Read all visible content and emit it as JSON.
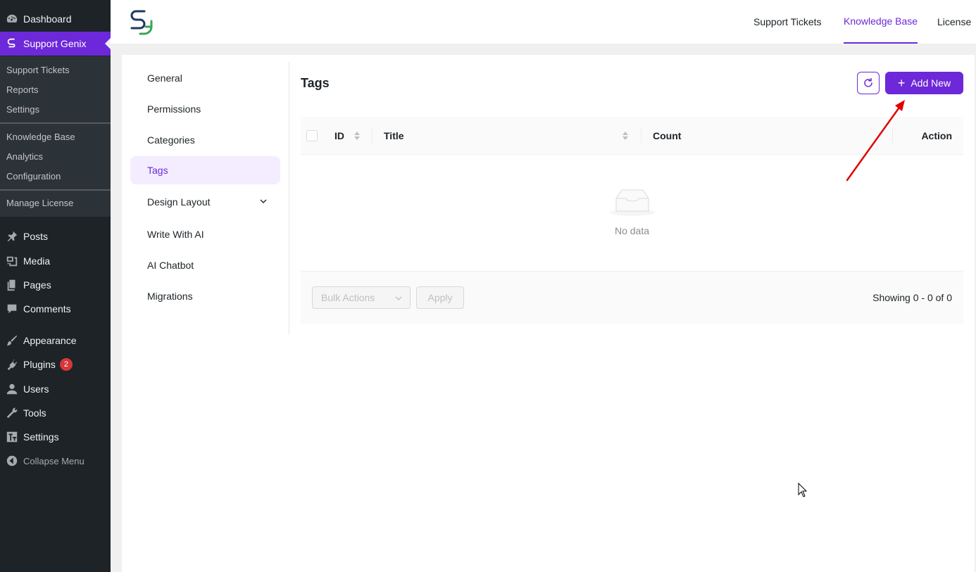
{
  "wp_menu": {
    "dashboard": "Dashboard",
    "support_genix": "Support Genix",
    "sub_items": [
      "Support Tickets",
      "Reports",
      "Settings",
      "Knowledge Base",
      "Analytics",
      "Configuration",
      "Manage License"
    ],
    "posts": "Posts",
    "media": "Media",
    "pages": "Pages",
    "comments": "Comments",
    "appearance": "Appearance",
    "plugins": "Plugins",
    "plugins_badge": "2",
    "users": "Users",
    "tools": "Tools",
    "settings": "Settings",
    "collapse": "Collapse Menu"
  },
  "header": {
    "nav": [
      "Support Tickets",
      "Knowledge Base",
      "License"
    ],
    "active_nav": "Knowledge Base"
  },
  "settings_nav": {
    "items": [
      "General",
      "Permissions",
      "Categories",
      "Tags",
      "Design Layout",
      "Write With AI",
      "AI Chatbot",
      "Migrations"
    ],
    "active": "Tags"
  },
  "main": {
    "title": "Tags",
    "add_new_label": "Add New",
    "table": {
      "columns": [
        "ID",
        "Title",
        "Count",
        "Action"
      ],
      "rows": [],
      "empty_text": "No data"
    },
    "footer": {
      "bulk_placeholder": "Bulk Actions",
      "apply_label": "Apply",
      "showing": "Showing 0 - 0 of 0"
    }
  },
  "colors": {
    "accent": "#6d28d9",
    "sidebar_bg": "#1d2327",
    "annotation_arrow": "#e00000"
  }
}
